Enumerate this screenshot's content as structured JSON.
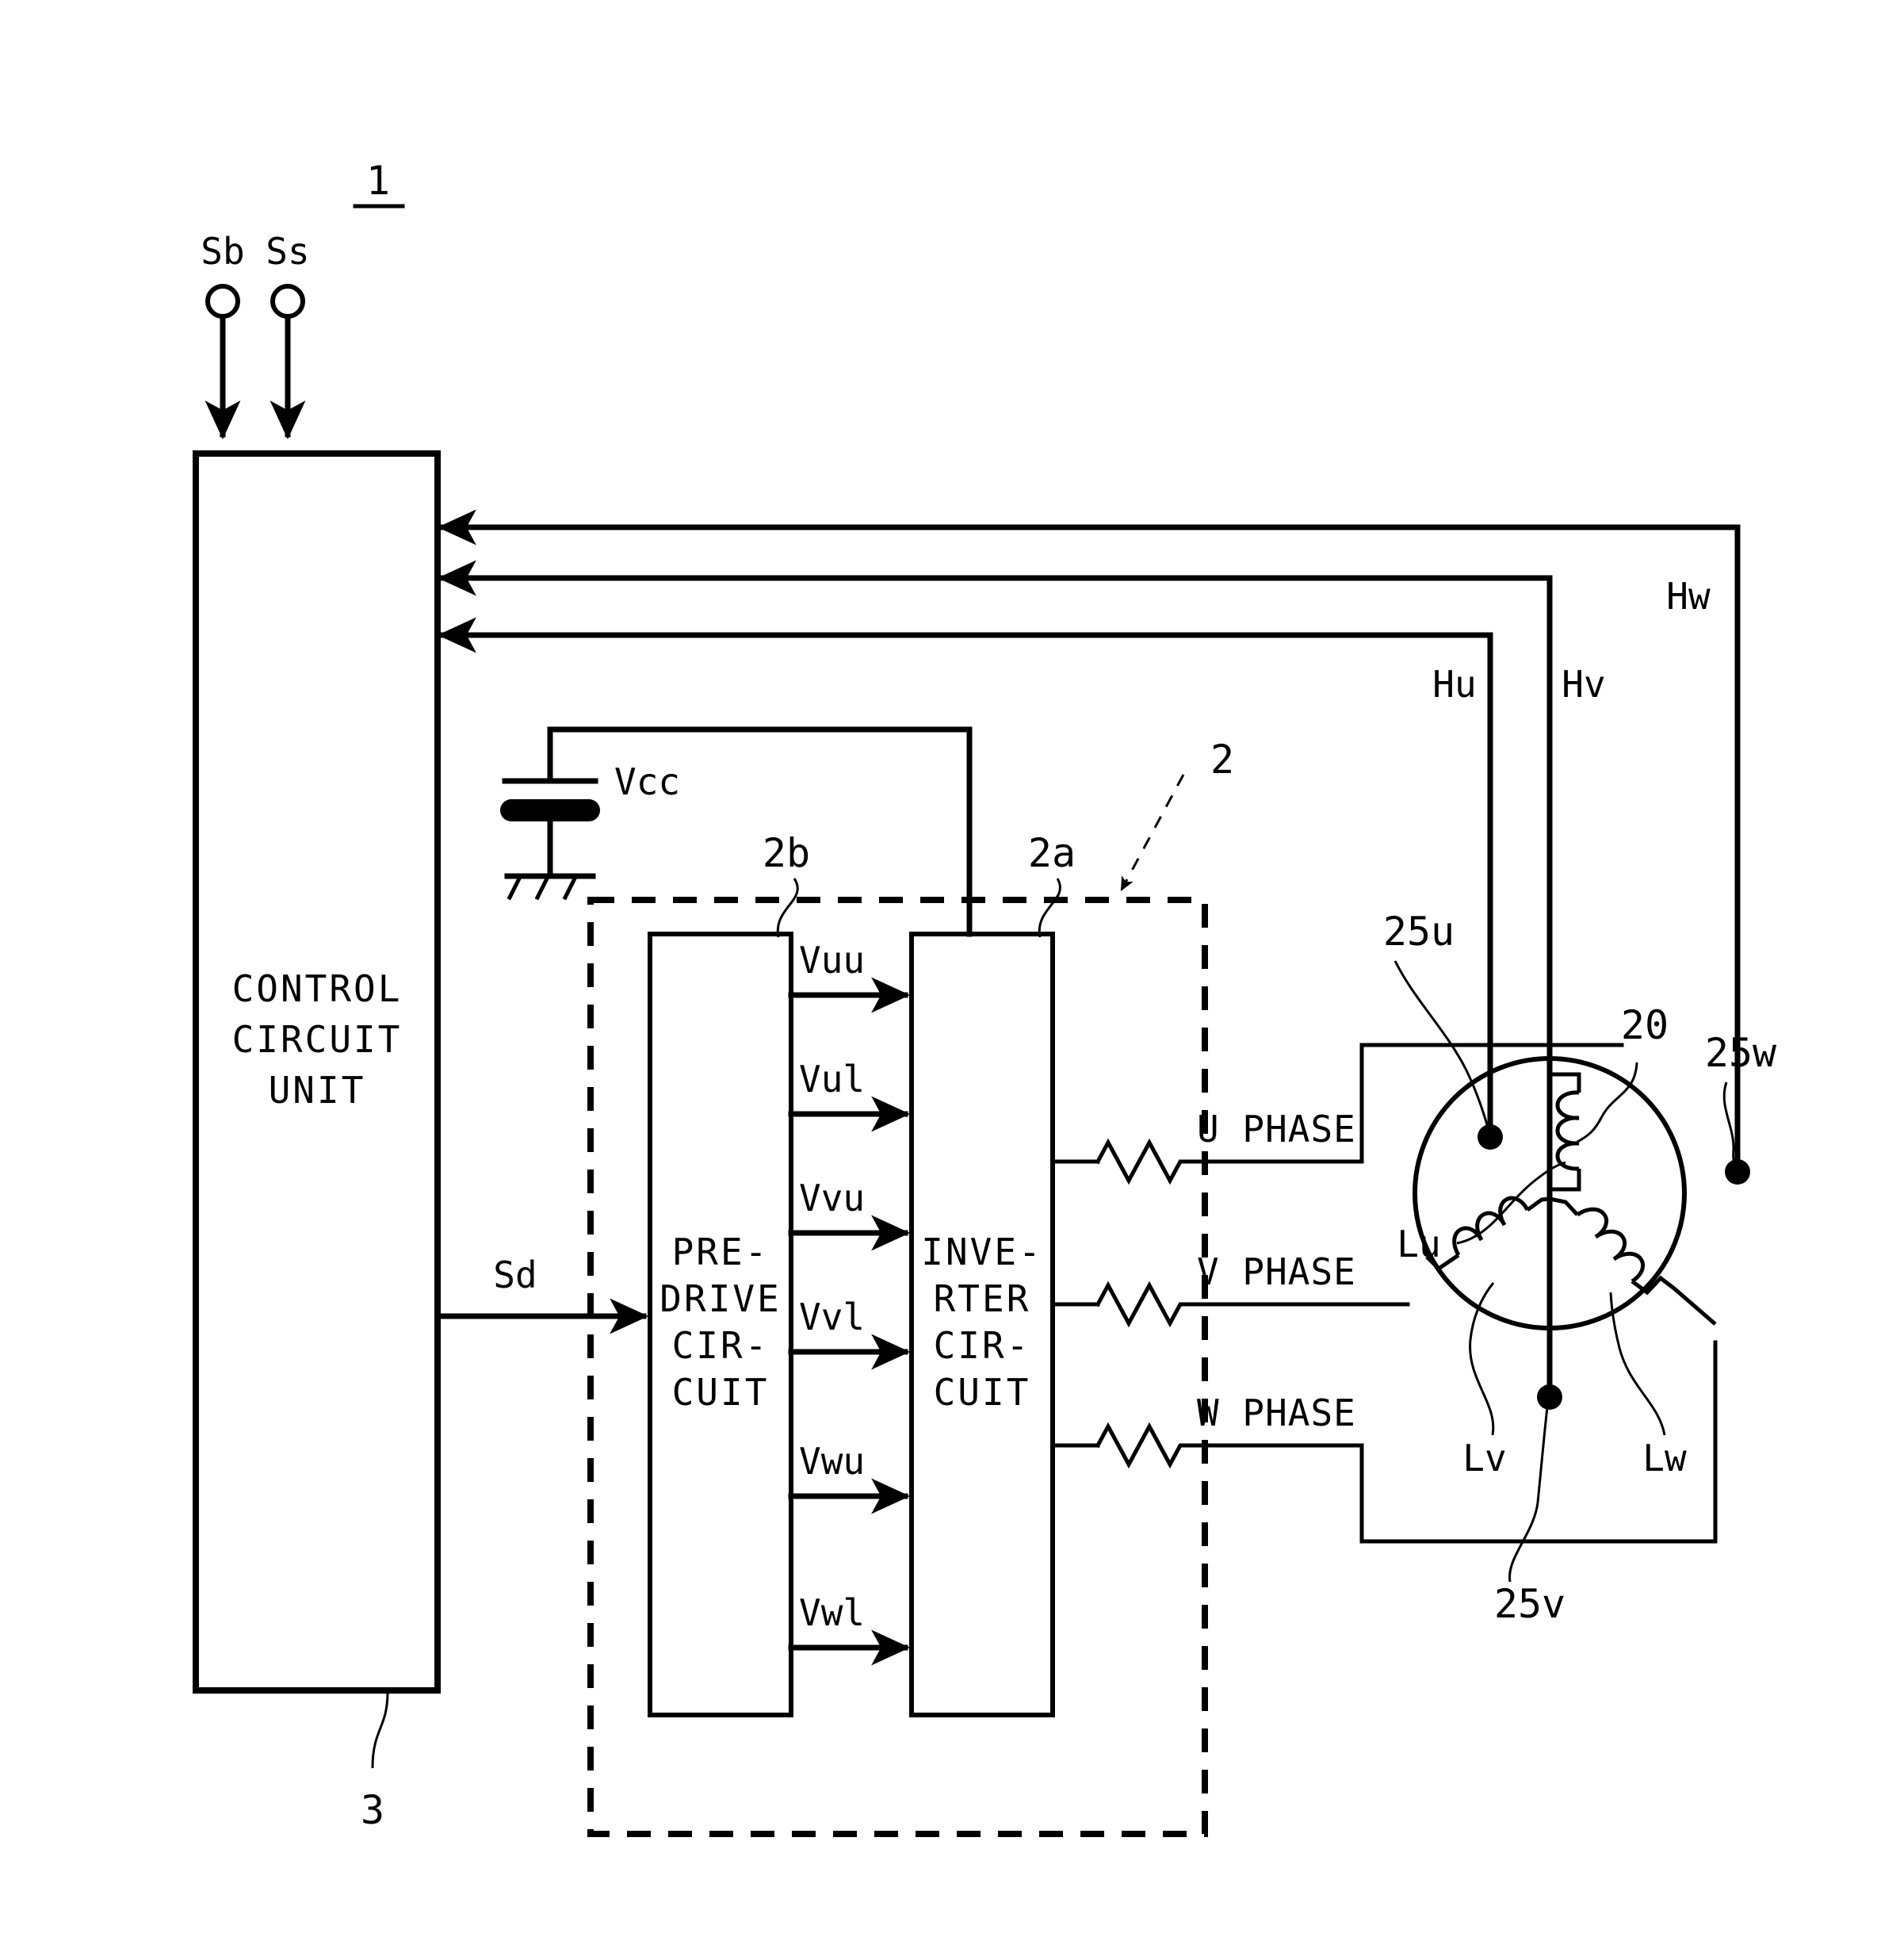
{
  "figure": {
    "number": "1",
    "reference_labels": {
      "controller_assembly": "1",
      "driver_assembly": "2",
      "inverter_ref": "2a",
      "predrive_ref": "2b",
      "control_unit_ref": "3",
      "motor_ref": "20",
      "hall_u_ref": "25u",
      "hall_v_ref": "25v",
      "hall_w_ref": "25w"
    }
  },
  "inputs": {
    "terminals": [
      {
        "name": "Sb"
      },
      {
        "name": "Ss"
      }
    ]
  },
  "blocks": {
    "control_unit": {
      "lines": [
        "CONTROL",
        "CIRCUIT",
        "UNIT"
      ],
      "ref": "3"
    },
    "predrive": {
      "lines": [
        "PRE-",
        "DRIVE",
        "CIR-",
        "CUIT"
      ],
      "ref": "2b"
    },
    "inverter": {
      "lines": [
        "INVE-",
        "RTER",
        "CIR-",
        "CUIT"
      ],
      "ref": "2a"
    }
  },
  "power": {
    "label": "Vcc",
    "capacitor": "capacitor-symbol",
    "ground": "ground-symbol"
  },
  "signals": {
    "drive_command": "Sd",
    "gate_signals": [
      "Vuu",
      "Vul",
      "Vvu",
      "Vvl",
      "Vwu",
      "Vwl"
    ],
    "hall_signals": [
      "Hu",
      "Hv",
      "Hw"
    ]
  },
  "phases": {
    "u": "U PHASE",
    "v": "V PHASE",
    "w": "W PHASE"
  },
  "motor": {
    "ref": "20",
    "windings": [
      {
        "name": "Lu"
      },
      {
        "name": "Lv"
      },
      {
        "name": "Lw"
      }
    ],
    "hall_sensors": [
      {
        "ref": "25u",
        "signal": "Hu"
      },
      {
        "ref": "25v",
        "signal": "Hv"
      },
      {
        "ref": "25w",
        "signal": "Hw"
      }
    ]
  },
  "colors": {
    "line": "#000000",
    "background": "#ffffff"
  }
}
